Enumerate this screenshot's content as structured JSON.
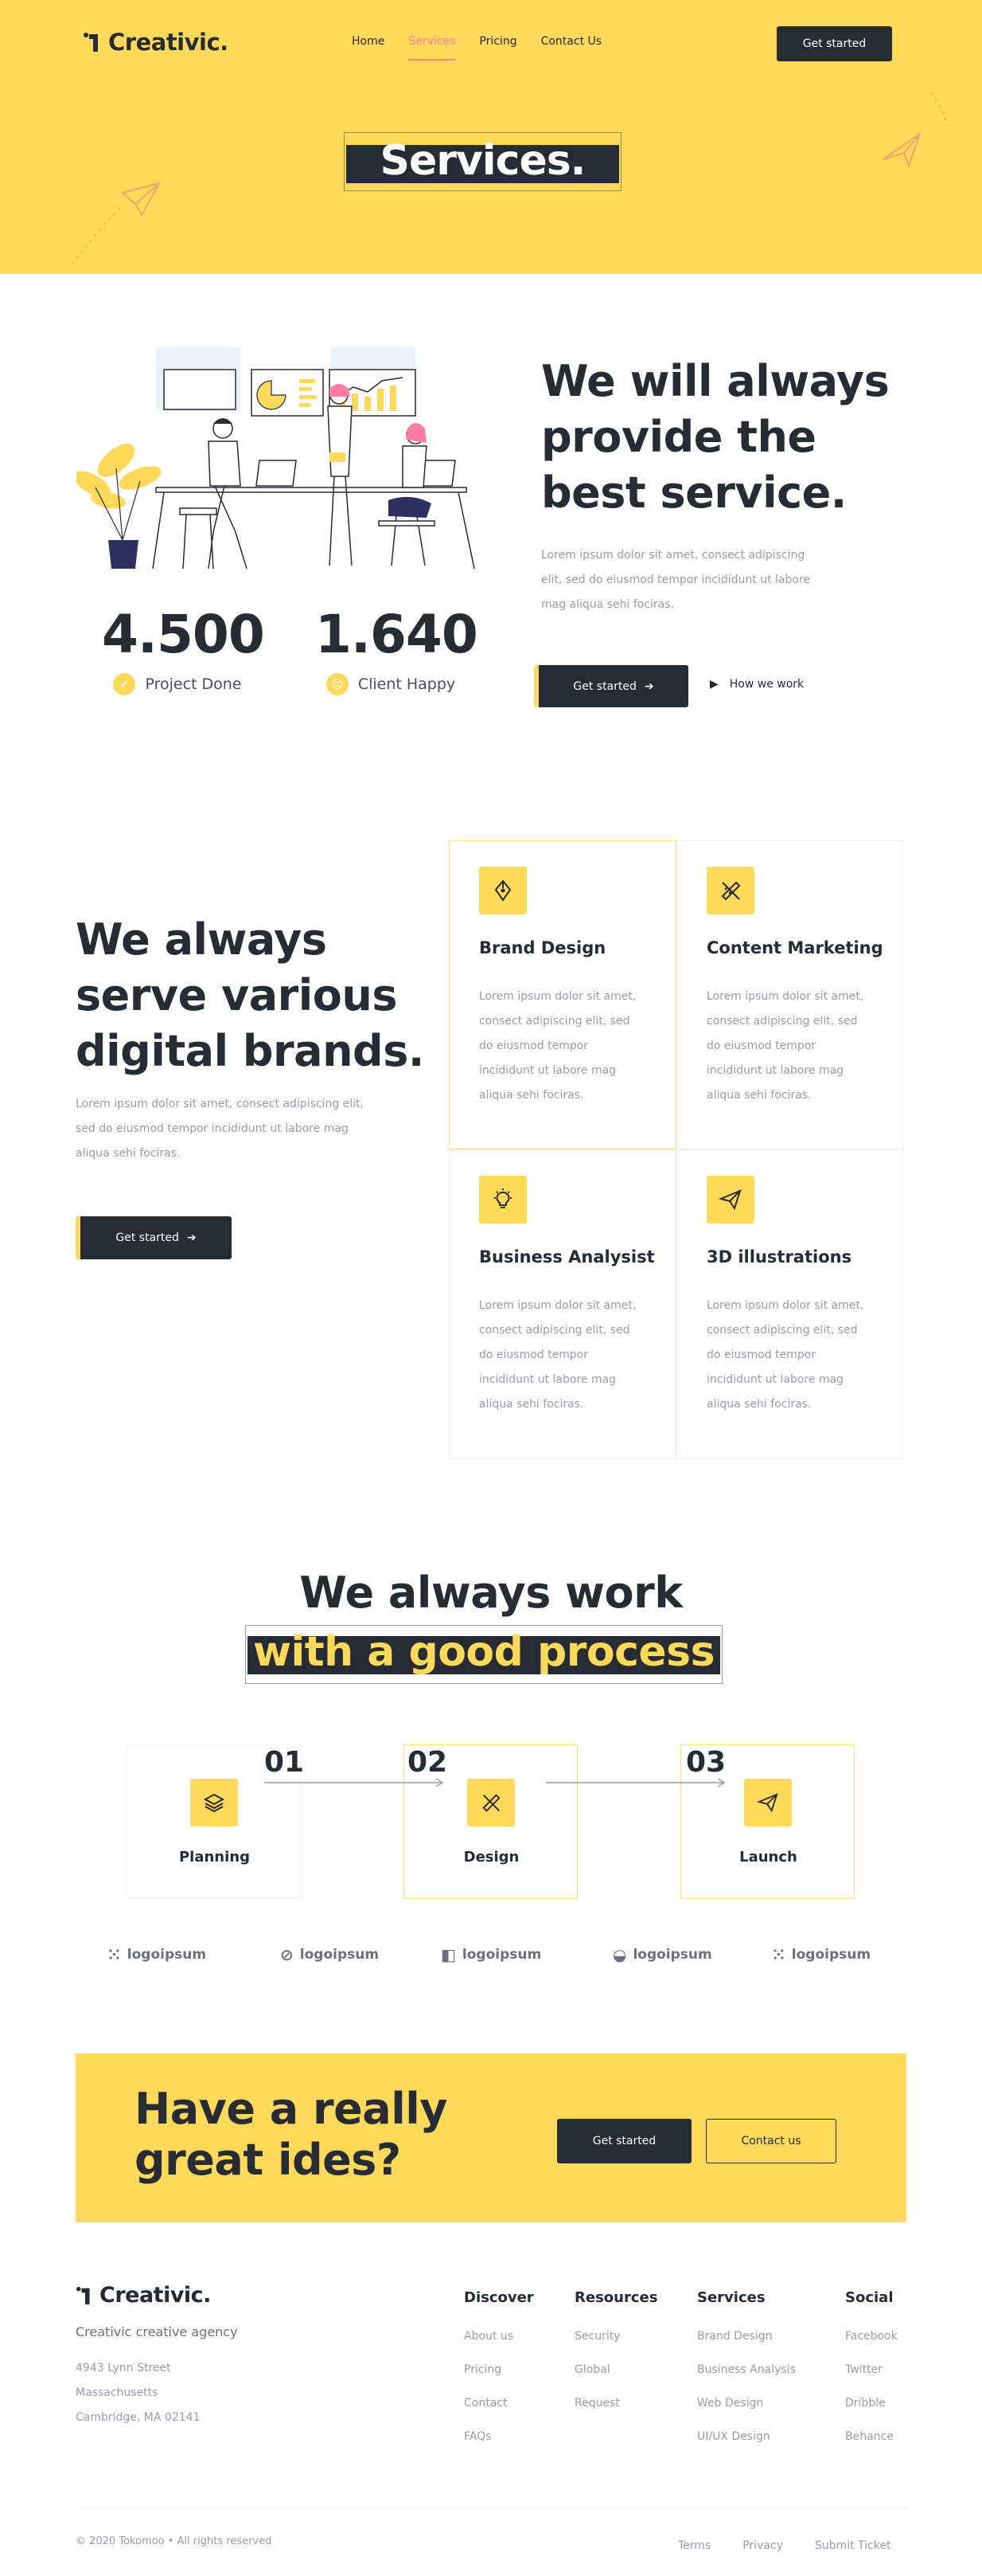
{
  "brand": {
    "name": "Creativic."
  },
  "nav": {
    "items": [
      {
        "label": "Home",
        "active": false
      },
      {
        "label": "Services",
        "active": true
      },
      {
        "label": "Pricing",
        "active": false
      },
      {
        "label": "Contact Us",
        "active": false
      }
    ],
    "cta_label": "Get started"
  },
  "hero": {
    "title": "Services."
  },
  "intro": {
    "heading_lines": [
      "We will always",
      "provide the",
      "best service."
    ],
    "paragraph_lines": [
      "Lorem ipsum dolor sit amet, consect adipiscing",
      "elit, sed do eiusmod tempor incididunt ut labore",
      "mag aliqua sehi fociras."
    ],
    "primary_button": "Get started",
    "secondary_button": "How we work",
    "stats": [
      {
        "value": "4.500",
        "label": "Project Done",
        "icon": "check-icon"
      },
      {
        "value": "1.640",
        "label": "Client Happy",
        "icon": "smile-icon"
      }
    ]
  },
  "brands": {
    "heading_lines": [
      "We always",
      "serve various",
      "digital brands."
    ],
    "paragraph_lines": [
      "Lorem ipsum dolor sit amet, consect adipiscing elit,",
      "sed do eiusmod tempor incididunt ut labore mag",
      "aliqua sehi fociras."
    ],
    "button": "Get started",
    "cards": [
      {
        "title": "Brand Design",
        "icon": "pen-nib-icon",
        "text_lines": [
          "Lorem ipsum dolor sit amet,",
          "consect adipiscing elit, sed",
          "do eiusmod tempor",
          "incididunt ut labore mag",
          "aliqua sehi fociras."
        ]
      },
      {
        "title": "Content Marketing",
        "icon": "pencil-ruler-icon",
        "text_lines": [
          "Lorem ipsum dolor sit amet,",
          "consect adipiscing elit, sed",
          "do eiusmod tempor",
          "incididunt ut labore mag",
          "aliqua sehi fociras."
        ]
      },
      {
        "title": "Business Analysist",
        "icon": "lightbulb-icon",
        "text_lines": [
          "Lorem ipsum dolor sit amet,",
          "consect adipiscing elit, sed",
          "do eiusmod tempor",
          "incididunt ut labore mag",
          "aliqua sehi fociras."
        ]
      },
      {
        "title": "3D illustrations",
        "icon": "paper-plane-icon",
        "text_lines": [
          "Lorem ipsum dolor sit amet,",
          "consect adipiscing elit, sed",
          "do eiusmod tempor",
          "incididunt ut labore mag",
          "aliqua sehi fociras."
        ]
      }
    ]
  },
  "process": {
    "heading_line1": "We always work",
    "heading_line2": "with a good process",
    "steps": [
      {
        "number": "01",
        "label": "Planning",
        "icon": "layers-icon"
      },
      {
        "number": "02",
        "label": "Design",
        "icon": "pencil-ruler-icon"
      },
      {
        "number": "03",
        "label": "Launch",
        "icon": "paper-plane-icon"
      }
    ]
  },
  "logos": [
    "logoipsum",
    "logoipsum",
    "logoipsum",
    "logoipsum",
    "logoipsum"
  ],
  "cta": {
    "heading_lines": [
      "Have a really",
      "great ides?"
    ],
    "primary_button": "Get started",
    "secondary_button": "Contact us"
  },
  "footer": {
    "brand": "Creativic.",
    "tagline": "Creativic creative agency",
    "address_lines": [
      "4943  Lynn Street",
      "Massachusetts",
      "Cambridge, MA 02141"
    ],
    "columns": [
      {
        "title": "Discover",
        "links": [
          "About us",
          "Pricing",
          "Contact",
          "FAQs"
        ]
      },
      {
        "title": "Resources",
        "links": [
          "Security",
          "Global",
          "Request"
        ]
      },
      {
        "title": "Services",
        "links": [
          "Brand Design",
          "Business Analysis",
          "Web Design",
          "UI/UX Design"
        ]
      },
      {
        "title": "Social",
        "links": [
          "Facebook",
          "Twitter",
          "Dribble",
          "Behance"
        ]
      }
    ],
    "copyright": "© 2020 Tokomoo • All rights reserved",
    "bottom_links": [
      "Terms",
      "Privacy",
      "Submit Ticket"
    ]
  },
  "colors": {
    "accent": "#ffd95a",
    "dark": "#272b33",
    "muted": "#9a9ca3",
    "pink": "#ff7da3"
  }
}
